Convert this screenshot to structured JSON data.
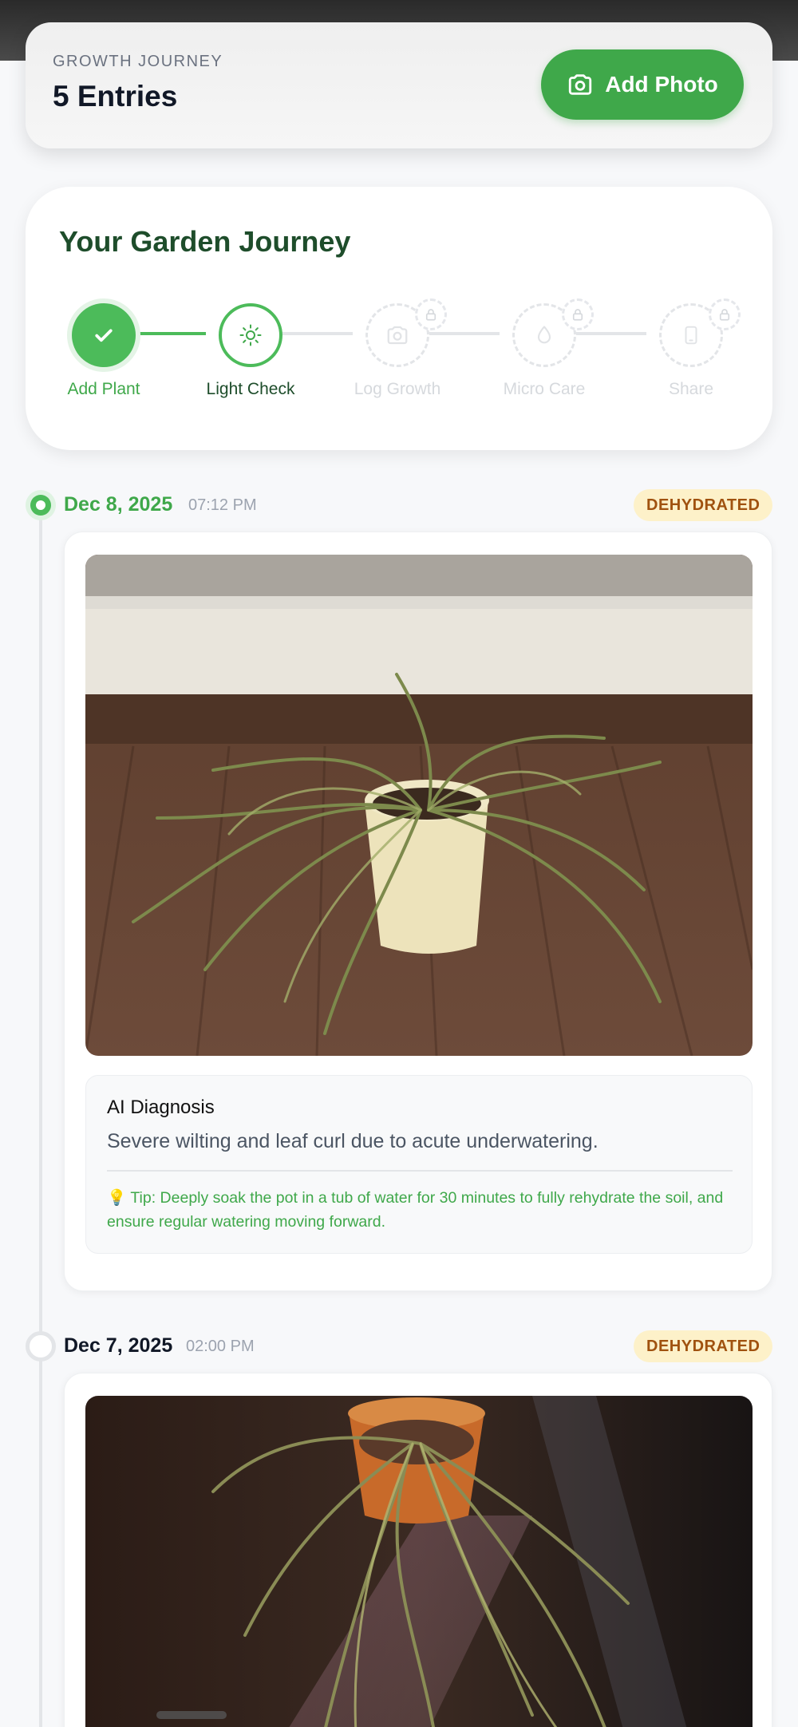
{
  "header": {
    "eyebrow": "GROWTH JOURNEY",
    "count": "5 Entries",
    "add_photo_label": "Add Photo",
    "add_photo_icon": "camera-icon"
  },
  "journey": {
    "title": "Your Garden Journey",
    "steps": [
      {
        "label": "Add Plant",
        "state": "completed",
        "icon": "check-icon"
      },
      {
        "label": "Light Check",
        "state": "active",
        "icon": "sun-icon"
      },
      {
        "label": "Log Growth",
        "state": "locked",
        "icon": "camera-icon"
      },
      {
        "label": "Micro Care",
        "state": "locked",
        "icon": "droplet-icon"
      },
      {
        "label": "Share",
        "state": "locked",
        "icon": "phone-icon"
      }
    ]
  },
  "entries": [
    {
      "date": "Dec 8, 2025",
      "time": "07:12 PM",
      "status": "DEHYDRATED",
      "diagnosis_title": "AI Diagnosis",
      "diagnosis_text": "Severe wilting and leaf curl due to acute underwatering.",
      "tip": "💡 Tip: Deeply soak the pot in a tub of water for 30 minutes to fully rehydrate the soil, and ensure regular watering moving forward."
    },
    {
      "date": "Dec 7, 2025",
      "time": "02:00 PM",
      "status": "DEHYDRATED"
    }
  ],
  "colors": {
    "brand_green": "#3fa84a",
    "title_green": "#1e4d2b",
    "badge_bg": "#fdf1c9",
    "badge_text": "#a0520f"
  }
}
